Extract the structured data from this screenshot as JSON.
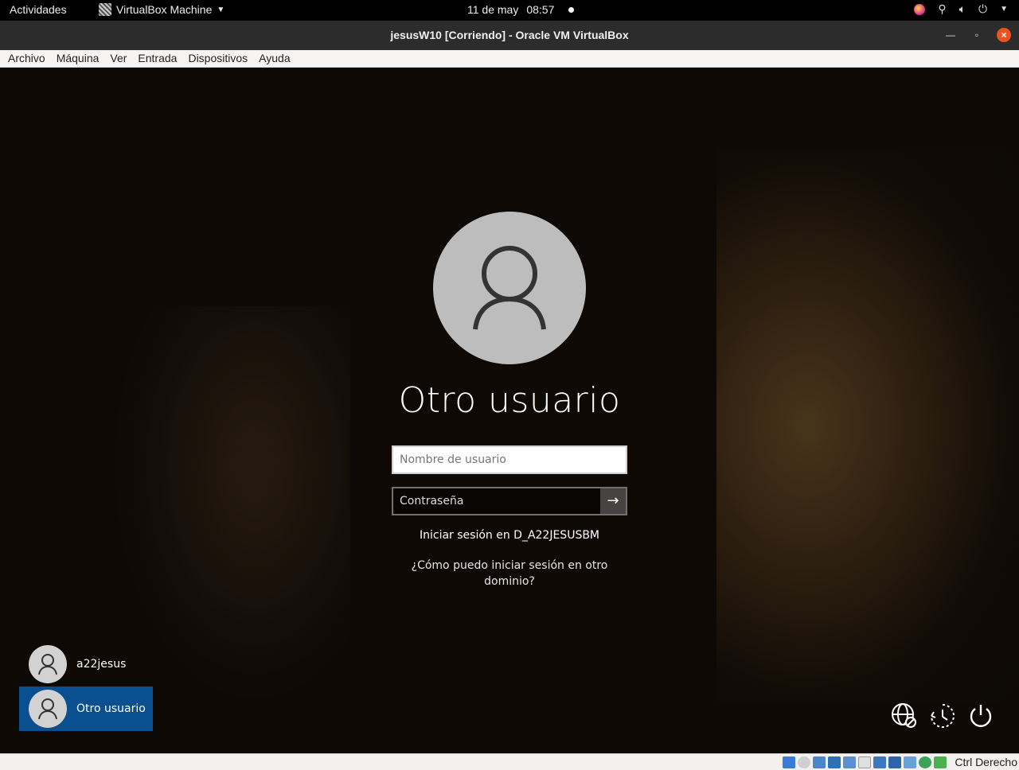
{
  "topbar": {
    "activities": "Actividades",
    "app_name": "VirtualBox Machine",
    "date": "11 de may",
    "time": "08:57"
  },
  "window": {
    "title": "jesusW10 [Corriendo] - Oracle VM VirtualBox"
  },
  "menubar": {
    "items": [
      "Archivo",
      "Máquina",
      "Ver",
      "Entrada",
      "Dispositivos",
      "Ayuda"
    ]
  },
  "login": {
    "display_name": "Otro usuario",
    "username_placeholder": "Nombre de usuario",
    "password_placeholder": "Contraseña",
    "sign_in_domain": "Iniciar sesión en D_A22JESUSBM",
    "other_domain_link": "¿Cómo puedo iniciar sesión en otro dominio?"
  },
  "users": [
    {
      "name": "a22jesus",
      "selected": false
    },
    {
      "name": "Otro usuario",
      "selected": true
    }
  ],
  "system_icons": [
    "network-icon",
    "ease-of-access-icon",
    "power-icon"
  ],
  "statusbar": {
    "host_key": "Ctrl Derecho"
  },
  "colors": {
    "selected_user_bg": "#0a4f8f",
    "ubuntu_close": "#e95420"
  }
}
